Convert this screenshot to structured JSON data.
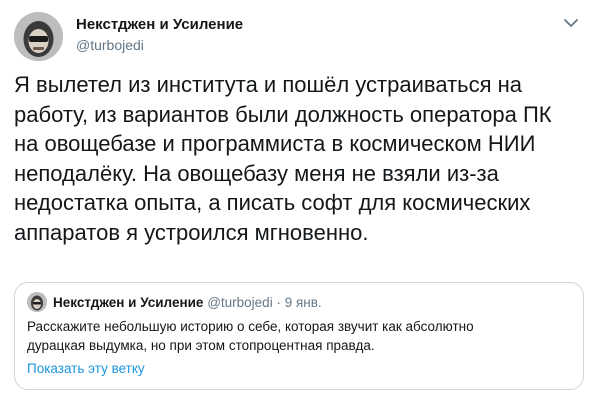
{
  "tweet": {
    "author": {
      "name": "Некстджен и Усиление",
      "handle": "@turbojedi"
    },
    "menu_icon": "chevron-down-icon",
    "text": "Я вылетел из института и пошёл устраиваться на\nработу, из вариантов были должность оператора ПК\nна овощебазе и программиста в космическом НИИ\nнеподалёку. На овощебазу меня не взяли из-за\nнедостатка опыта, а писать софт для космических\nаппаратов я устроился мгновенно."
  },
  "quoted_tweet": {
    "author": {
      "name": "Некстджен и Усиление",
      "handle": "@turbojedi",
      "separator": "·",
      "date": "9 янв."
    },
    "text": "Расскажите небольшую историю о себе, которая звучит как абсолютно\nдурацкая выдумка, но при этом стопроцентная правда.",
    "show_thread": "Показать эту ветку"
  },
  "colors": {
    "text": "#14171a",
    "secondary": "#657786",
    "link": "#1b95e0",
    "border": "#ccd6dd"
  }
}
